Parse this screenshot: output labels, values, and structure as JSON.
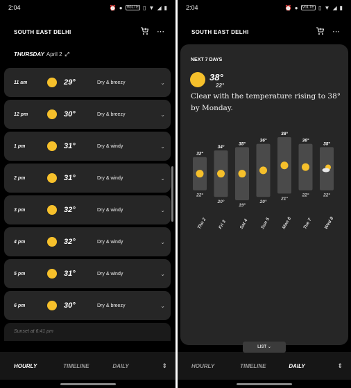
{
  "status_bar": {
    "time": "2:04",
    "vol_badge": "VoLTE"
  },
  "left_screen": {
    "location": "SOUTH EAST DELHI",
    "icons": [
      "add-cart-icon",
      "more-icon"
    ],
    "day": {
      "label": "THURSDAY",
      "date": "April 2",
      "expand_glyph": "⤢"
    },
    "hours": [
      {
        "time": "11 am",
        "temp": "29°",
        "condition": "Dry & breezy"
      },
      {
        "time": "12 pm",
        "temp": "30°",
        "condition": "Dry & breezy"
      },
      {
        "time": "1 pm",
        "temp": "31°",
        "condition": "Dry & windy"
      },
      {
        "time": "2 pm",
        "temp": "31°",
        "condition": "Dry & windy"
      },
      {
        "time": "3 pm",
        "temp": "32°",
        "condition": "Dry & windy"
      },
      {
        "time": "4 pm",
        "temp": "32°",
        "condition": "Dry & windy"
      },
      {
        "time": "5 pm",
        "temp": "31°",
        "condition": "Dry & windy"
      },
      {
        "time": "6 pm",
        "temp": "30°",
        "condition": "Dry & breezy"
      }
    ],
    "sunset": "Sunset at 6:41 pm",
    "nav": {
      "hourly": "HOURLY",
      "timeline": "TIMELINE",
      "daily": "DAILY",
      "active": "hourly"
    }
  },
  "right_screen": {
    "location": "SOUTH EAST DELHI",
    "card": {
      "title": "NEXT 7 DAYS",
      "today_high": "38°",
      "today_low": "22°",
      "summary": "Clear with the temperature rising to 38° by Monday."
    },
    "list_button": "LIST",
    "nav": {
      "hourly": "HOURLY",
      "timeline": "TIMELINE",
      "daily": "DAILY",
      "active": "daily"
    }
  },
  "colors": {
    "sun": "#f6c02b",
    "card": "#262626",
    "background": "#000000"
  },
  "chart_data": {
    "type": "range-bar",
    "categories": [
      "Thu 2",
      "Fri 3",
      "Sat 4",
      "Sun 5",
      "Mon 6",
      "Tue 7",
      "Wed 8"
    ],
    "series": [
      {
        "name": "high",
        "values": [
          32,
          34,
          35,
          36,
          38,
          36,
          35
        ]
      },
      {
        "name": "low",
        "values": [
          22,
          20,
          19,
          20,
          21,
          22,
          22
        ]
      }
    ],
    "high_labels": [
      "32°",
      "34°",
      "35°",
      "36°",
      "38°",
      "36°",
      "35°"
    ],
    "low_labels": [
      "22°",
      "20°",
      "19°",
      "20°",
      "21°",
      "22°",
      "22°"
    ],
    "icons": [
      "sun-icon",
      "sun-icon",
      "sun-icon",
      "sun-icon",
      "sun-icon",
      "sun-icon",
      "partly-cloudy-icon"
    ]
  }
}
